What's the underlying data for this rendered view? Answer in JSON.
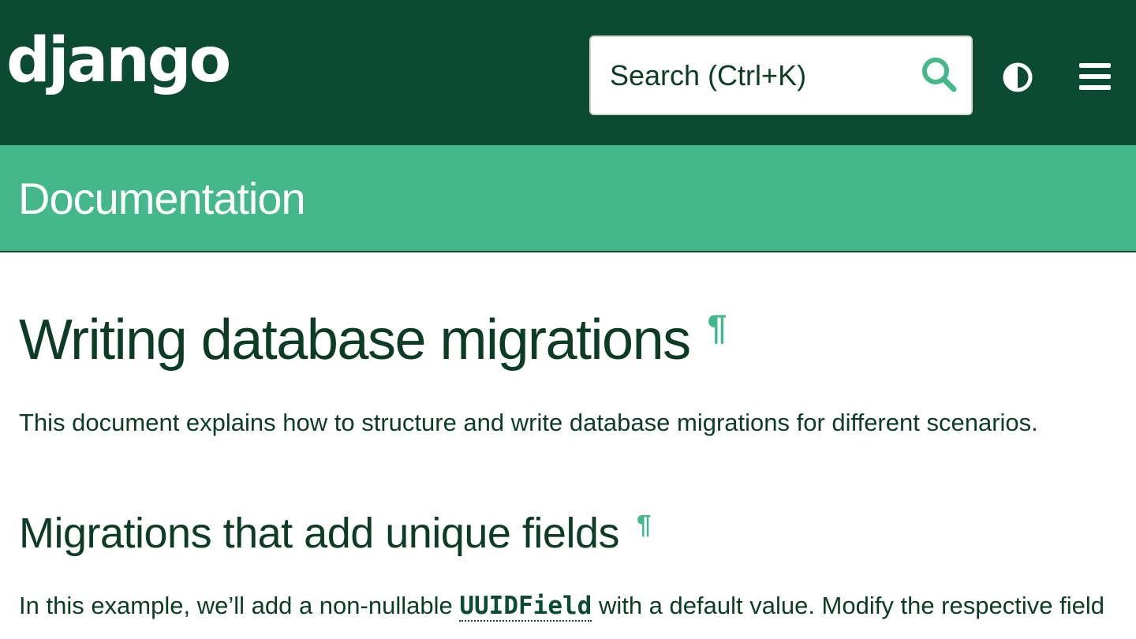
{
  "header": {
    "logo_text": "django",
    "search": {
      "placeholder": "Search (Ctrl+K)",
      "value": ""
    },
    "icons": [
      "search-icon",
      "theme-toggle-icon",
      "menu-icon"
    ]
  },
  "subheader": {
    "title": "Documentation"
  },
  "main": {
    "title": "Writing database migrations",
    "intro": "This document explains how to structure and write database migrations for different scenarios.",
    "section": {
      "heading": "Migrations that add unique fields",
      "para_before": "In this example, we’ll add a non-nullable ",
      "code": "UUIDField",
      "para_after": " with a default value. Modify the respective field"
    },
    "anchor_symbol": "¶"
  },
  "colors": {
    "header_bg": "#0c4b33",
    "subheader_bg": "#44b78b",
    "accent": "#44b78b",
    "text": "#0c3c26"
  }
}
